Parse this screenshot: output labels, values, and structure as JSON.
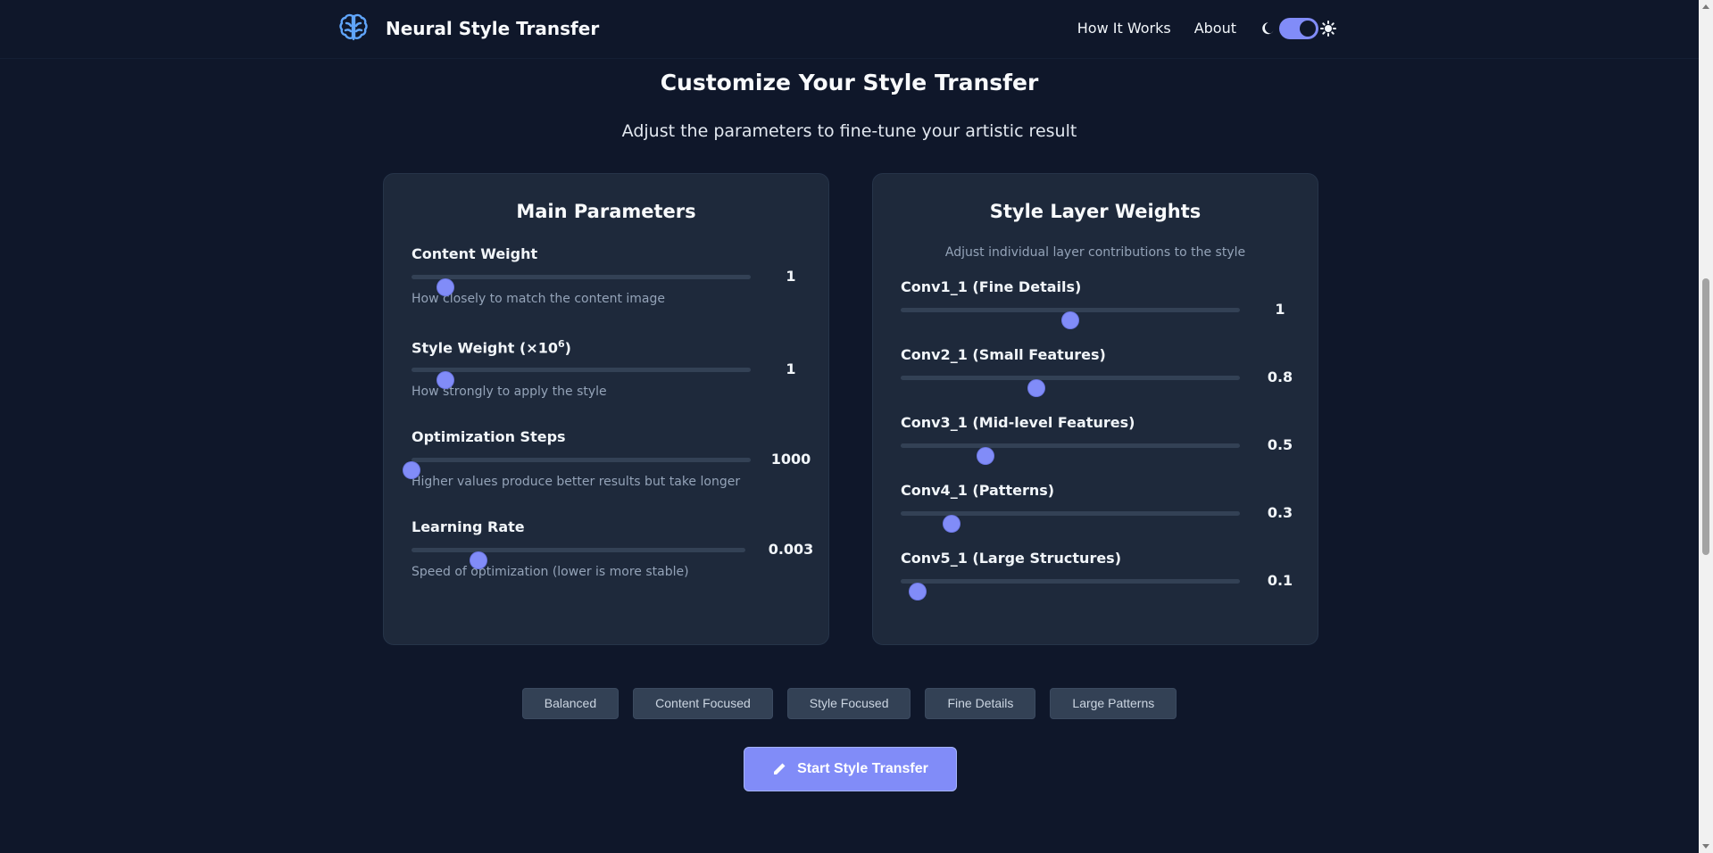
{
  "navbar": {
    "title": "Neural Style Transfer",
    "links": [
      "How It Works",
      "About"
    ],
    "theme_toggle_on": true
  },
  "section": {
    "title": "Customize Your Style Transfer",
    "subtitle": "Adjust the parameters to fine-tune your artistic result"
  },
  "main_params": {
    "title": "Main Parameters",
    "items": [
      {
        "label": "Content Weight",
        "value": "1",
        "level": 0.1,
        "help": "How closely to match the content image"
      },
      {
        "label": "Style Weight (×10",
        "label_sup": "6",
        "label_tail": ")",
        "value": "1",
        "level": 0.1,
        "help": "How strongly to apply the style"
      },
      {
        "label": "Optimization Steps",
        "value": "1000",
        "level": 0.0,
        "help": "Higher values produce better results but take longer"
      },
      {
        "label": "Learning Rate",
        "value": "0.003",
        "level": 0.2,
        "help": "Speed of optimization (lower is more stable)"
      }
    ]
  },
  "layer_weights": {
    "title": "Style Layer Weights",
    "note": "Adjust individual layer contributions to the style",
    "items": [
      {
        "label": "Conv1_1 (Fine Details)",
        "value": "1",
        "level": 0.5
      },
      {
        "label": "Conv2_1 (Small Features)",
        "value": "0.8",
        "level": 0.4
      },
      {
        "label": "Conv3_1 (Mid-level Features)",
        "value": "0.5",
        "level": 0.25
      },
      {
        "label": "Conv4_1 (Patterns)",
        "value": "0.3",
        "level": 0.15
      },
      {
        "label": "Conv5_1 (Large Structures)",
        "value": "0.1",
        "level": 0.05
      }
    ]
  },
  "presets": [
    "Balanced",
    "Content Focused",
    "Style Focused",
    "Fine Details",
    "Large Patterns"
  ],
  "start_button": "Start Style Transfer",
  "colors": {
    "background": "#0f172a",
    "card": "#1e293b",
    "accent": "#818cf8",
    "brand_icon": "#60a5fa"
  },
  "icons": [
    "brain-icon",
    "moon-icon",
    "sun-icon",
    "pencil-icon"
  ]
}
